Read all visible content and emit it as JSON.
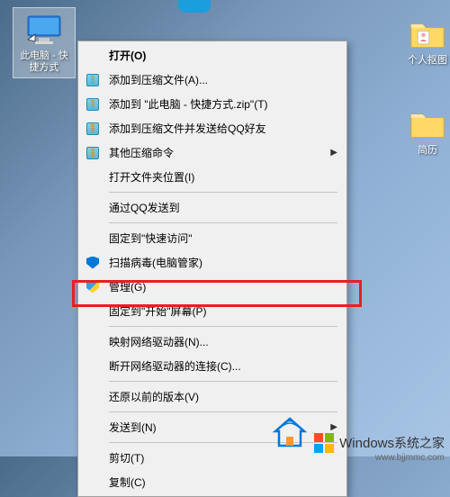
{
  "desktop": {
    "this_pc": {
      "label": "此电脑 - 快捷方式"
    },
    "person_cutout": {
      "label": "个人抠图"
    },
    "resume": {
      "label": "简历"
    }
  },
  "context_menu": {
    "open": "打开(O)",
    "add_to_archive": "添加到压缩文件(A)...",
    "add_to_zip": "添加到 \"此电脑 - 快捷方式.zip\"(T)",
    "add_and_send_qq": "添加到压缩文件并发送给QQ好友",
    "other_archive": "其他压缩命令",
    "open_file_location": "打开文件夹位置(I)",
    "send_via_qq": "通过QQ发送到",
    "pin_quick_access": "固定到\"快速访问\"",
    "scan_virus": "扫描病毒(电脑管家)",
    "manage": "管理(G)",
    "pin_start": "固定到\"开始\"屏幕(P)",
    "map_network_drive": "映射网络驱动器(N)...",
    "disconnect_network_drive": "断开网络驱动器的连接(C)...",
    "restore_previous": "还原以前的版本(V)",
    "send_to": "发送到(N)",
    "cut": "剪切(T)",
    "copy": "复制(C)"
  },
  "watermark": {
    "brand": "Windows",
    "suffix": "系统之家",
    "url": "www.bjjmmc.com"
  }
}
